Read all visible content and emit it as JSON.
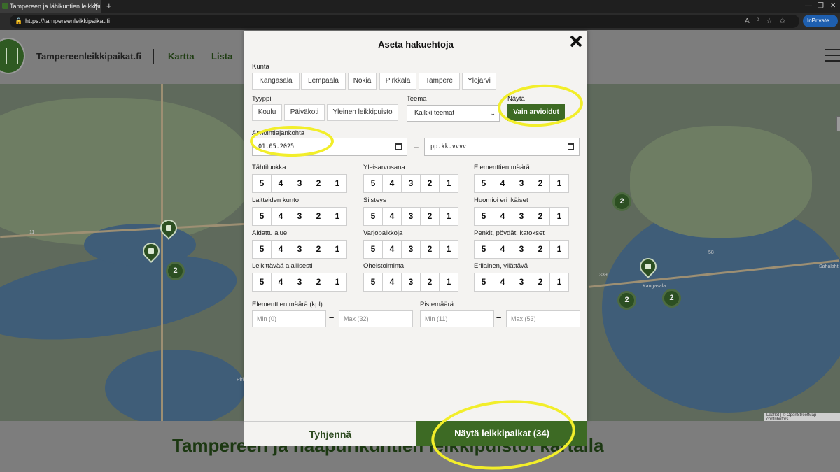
{
  "browser": {
    "tab_title": "Tampereen ja lähikuntien leikkipu...",
    "url": "https://tampereenleikkipaikat.fi",
    "inprivate_label": "InPrivate"
  },
  "site": {
    "brand": "Tampereenleikkipaikat.fi",
    "nav": [
      "Kartta",
      "Lista"
    ]
  },
  "map": {
    "clusters": [
      "2",
      "2",
      "2",
      "2"
    ],
    "place_labels": [
      "Kangasala",
      "Sahalahti",
      "Pirkkala"
    ],
    "road_labels": [
      "11",
      "58",
      "339"
    ],
    "attribution": "Leaflet | © OpenStreetMap contributors"
  },
  "page_heading": "Tampereen ja naapurikuntien leikkipuistot kartalla",
  "modal": {
    "title": "Aseta hakuehtoja",
    "kunta_label": "Kunta",
    "kunta_options": [
      "Kangasala",
      "Lempäälä",
      "Nokia",
      "Pirkkala",
      "Tampere",
      "Ylöjärvi"
    ],
    "tyyppi_label": "Tyyppi",
    "tyyppi_options": [
      "Koulu",
      "Päiväkoti",
      "Yleinen leikkipuisto"
    ],
    "teema_label": "Teema",
    "teema_value": "Kaikki teemat",
    "nayta_label": "Näytä",
    "nayta_button": "Vain arvioidut",
    "date_label": "Arviointiajankohta",
    "date_from": "01.05.2025",
    "date_to": "pp.kk.vvvv",
    "rating_values": [
      "5",
      "4",
      "3",
      "2",
      "1"
    ],
    "ratings": [
      "Tähtiluokka",
      "Yleisarvosana",
      "Elementtien määrä",
      "Laitteiden kunto",
      "Siisteys",
      "Huomioi eri ikäiset",
      "Aidattu alue",
      "Varjopaikkoja",
      "Penkit, pöydät, katokset",
      "Leikittävää ajallisesti",
      "Oheistoiminta",
      "Erilainen, yllättävä"
    ],
    "elements_label": "Elementtien määrä (kpl)",
    "elements_min": "Min (0)",
    "elements_max": "Max (32)",
    "points_label": "Pistemäärä",
    "points_min": "Min (11)",
    "points_max": "Max (53)",
    "clear_button": "Tyhjennä",
    "show_button": "Näytä leikkipaikat (34)"
  }
}
